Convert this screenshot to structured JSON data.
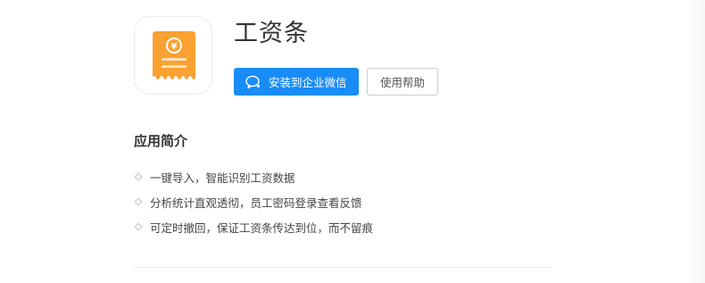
{
  "app": {
    "name": "工资条",
    "icon": "payslip-icon",
    "icon_color": "#fba131"
  },
  "actions": {
    "install_label": "安装到企业微信",
    "install_icon": "wechat-work-icon",
    "install_color": "#1a8cf7",
    "help_label": "使用帮助"
  },
  "intro": {
    "title": "应用简介",
    "items": [
      "一键导入，智能识别工资数据",
      "分析统计直观透彻，员工密码登录查看反馈",
      "可定时撤回，保证工资条传达到位，而不留痕"
    ]
  }
}
